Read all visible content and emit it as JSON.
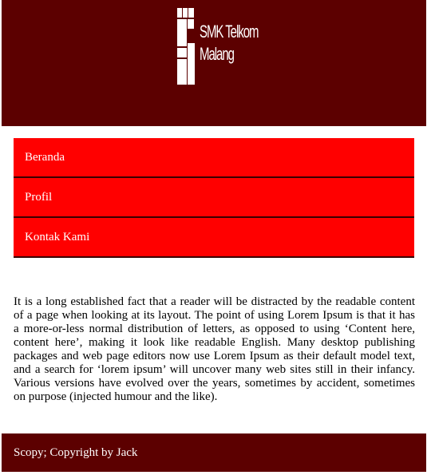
{
  "header": {
    "logo": {
      "icon": "school-logo-icon",
      "text_line1": "SMK Telkom",
      "text_line2": "Malang"
    }
  },
  "nav": {
    "items": [
      {
        "label": "Beranda"
      },
      {
        "label": "Profil"
      },
      {
        "label": "Kontak Kami"
      }
    ]
  },
  "main": {
    "paragraph": "It is a long established fact that a reader will be distracted by the readable content of a page when looking at its layout. The point of using Lorem Ipsum is that it has a more-or-less normal distribution of letters, as opposed to using ‘Content here, content here’, making it look like readable English. Many desktop publishing packages and web page editors now use Lorem Ipsum as their default model text, and a search for ‘lorem ipsum’ will uncover many web sites still in their infancy. Various versions have evolved over the years, sometimes by accident, sometimes on purpose (injected humour and the like)."
  },
  "footer": {
    "text": "Scopy; Copyright by Jack"
  },
  "colors": {
    "header_bg": "#5c0000",
    "nav_bg": "#ff0000",
    "nav_divider": "#3a0000",
    "footer_bg": "#5c0000",
    "text_light": "#ffffff"
  }
}
